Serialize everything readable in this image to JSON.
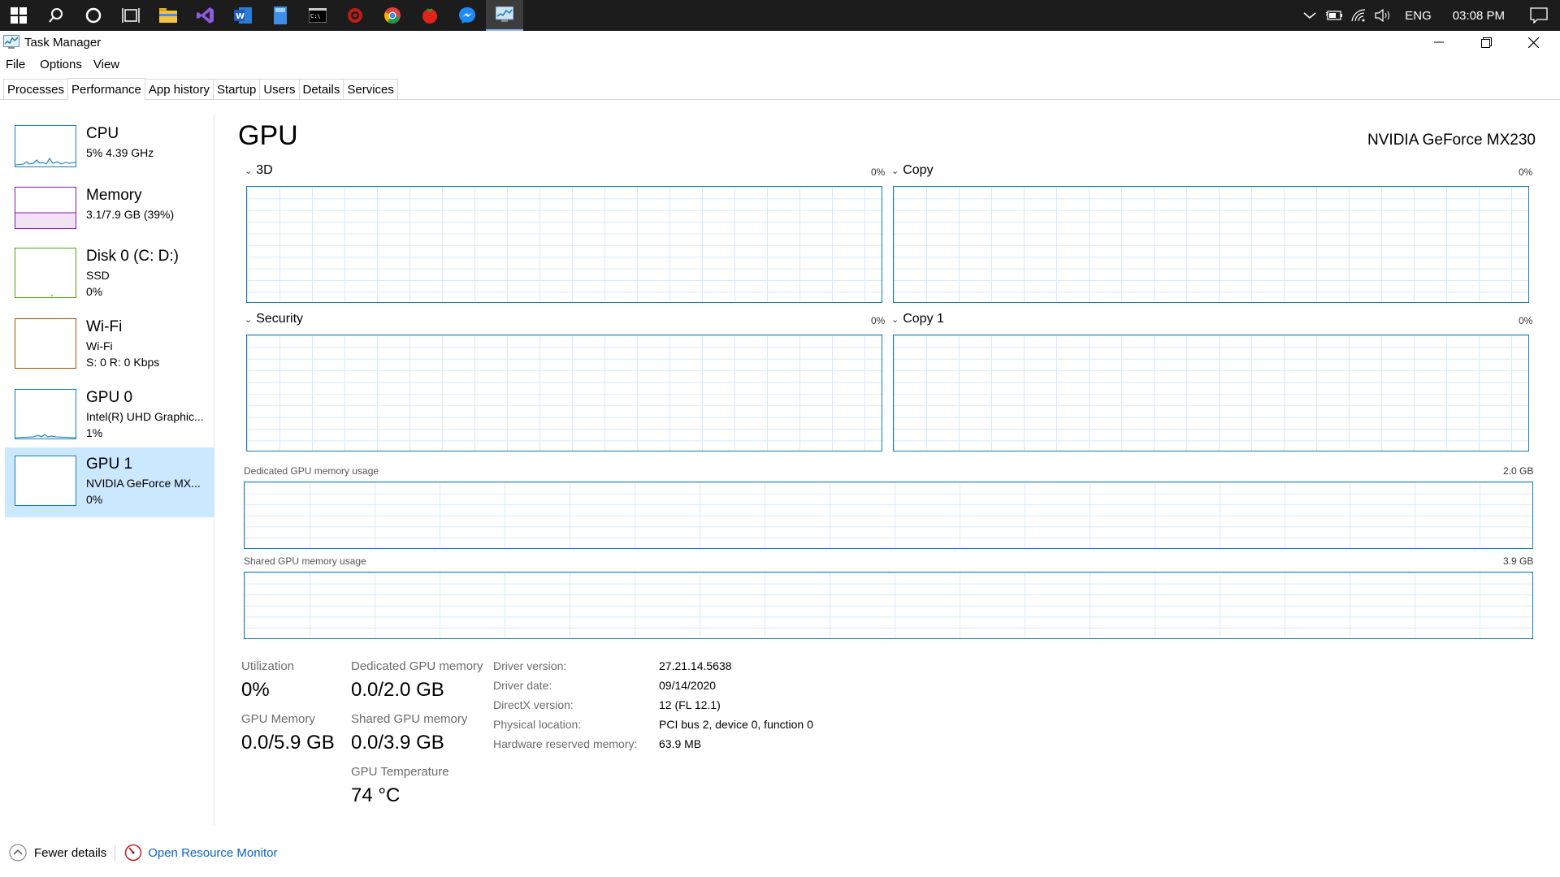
{
  "taskbar": {
    "apps": [
      "start-icon",
      "search-icon",
      "cortana-icon",
      "task-view-icon",
      "file-explorer-icon",
      "visual-studio-icon",
      "word-icon",
      "notepad-icon",
      "terminal-icon",
      "red-app-icon",
      "chrome-icon",
      "tomato-icon",
      "messenger-icon",
      "task-manager-icon"
    ],
    "tray": {
      "language": "ENG",
      "time": "03:08 PM"
    }
  },
  "window": {
    "title": "Task Manager",
    "menu": [
      "File",
      "Options",
      "View"
    ],
    "tabs": [
      "Processes",
      "Performance",
      "App history",
      "Startup",
      "Users",
      "Details",
      "Services"
    ],
    "selected_tab": "Performance"
  },
  "sidebar": {
    "items": [
      {
        "name": "CPU",
        "sub1": "5%  4.39 GHz",
        "sub2": "",
        "color": "#117dbb"
      },
      {
        "name": "Memory",
        "sub1": "3.1/7.9 GB (39%)",
        "sub2": "",
        "color": "#8b12ae"
      },
      {
        "name": "Disk 0 (C: D:)",
        "sub1": "SSD",
        "sub2": "0%",
        "color": "#4da60c"
      },
      {
        "name": "Wi-Fi",
        "sub1": "Wi-Fi",
        "sub2": "S: 0  R: 0 Kbps",
        "color": "#a74f01"
      },
      {
        "name": "GPU 0",
        "sub1": "Intel(R) UHD Graphic...",
        "sub2": "1%",
        "color": "#117dbb"
      },
      {
        "name": "GPU 1",
        "sub1": "NVIDIA GeForce MX...",
        "sub2": "0%",
        "color": "#117dbb"
      }
    ]
  },
  "main": {
    "title": "GPU",
    "model": "NVIDIA GeForce MX230",
    "engines": [
      {
        "name": "3D",
        "pct": "0%"
      },
      {
        "name": "Copy",
        "pct": "0%"
      },
      {
        "name": "Security",
        "pct": "0%"
      },
      {
        "name": "Copy 1",
        "pct": "0%"
      }
    ],
    "dedicated": {
      "label": "Dedicated GPU memory usage",
      "max": "2.0 GB"
    },
    "shared": {
      "label": "Shared GPU memory usage",
      "max": "3.9 GB"
    },
    "stats": {
      "utilization_label": "Utilization",
      "utilization": "0%",
      "dedicated_label": "Dedicated GPU memory",
      "dedicated": "0.0/2.0 GB",
      "gpu_memory_label": "GPU Memory",
      "gpu_memory": "0.0/5.9 GB",
      "shared_label": "Shared GPU memory",
      "shared": "0.0/3.9 GB",
      "temp_label": "GPU Temperature",
      "temp": "74 °C"
    },
    "info": [
      {
        "label": "Driver version:",
        "value": "27.21.14.5638"
      },
      {
        "label": "Driver date:",
        "value": "09/14/2020"
      },
      {
        "label": "DirectX version:",
        "value": "12 (FL 12.1)"
      },
      {
        "label": "Physical location:",
        "value": "PCI bus 2, device 0, function 0"
      },
      {
        "label": "Hardware reserved memory:",
        "value": "63.9 MB"
      }
    ]
  },
  "footer": {
    "fewer": "Fewer details",
    "resmon": "Open Resource Monitor"
  }
}
